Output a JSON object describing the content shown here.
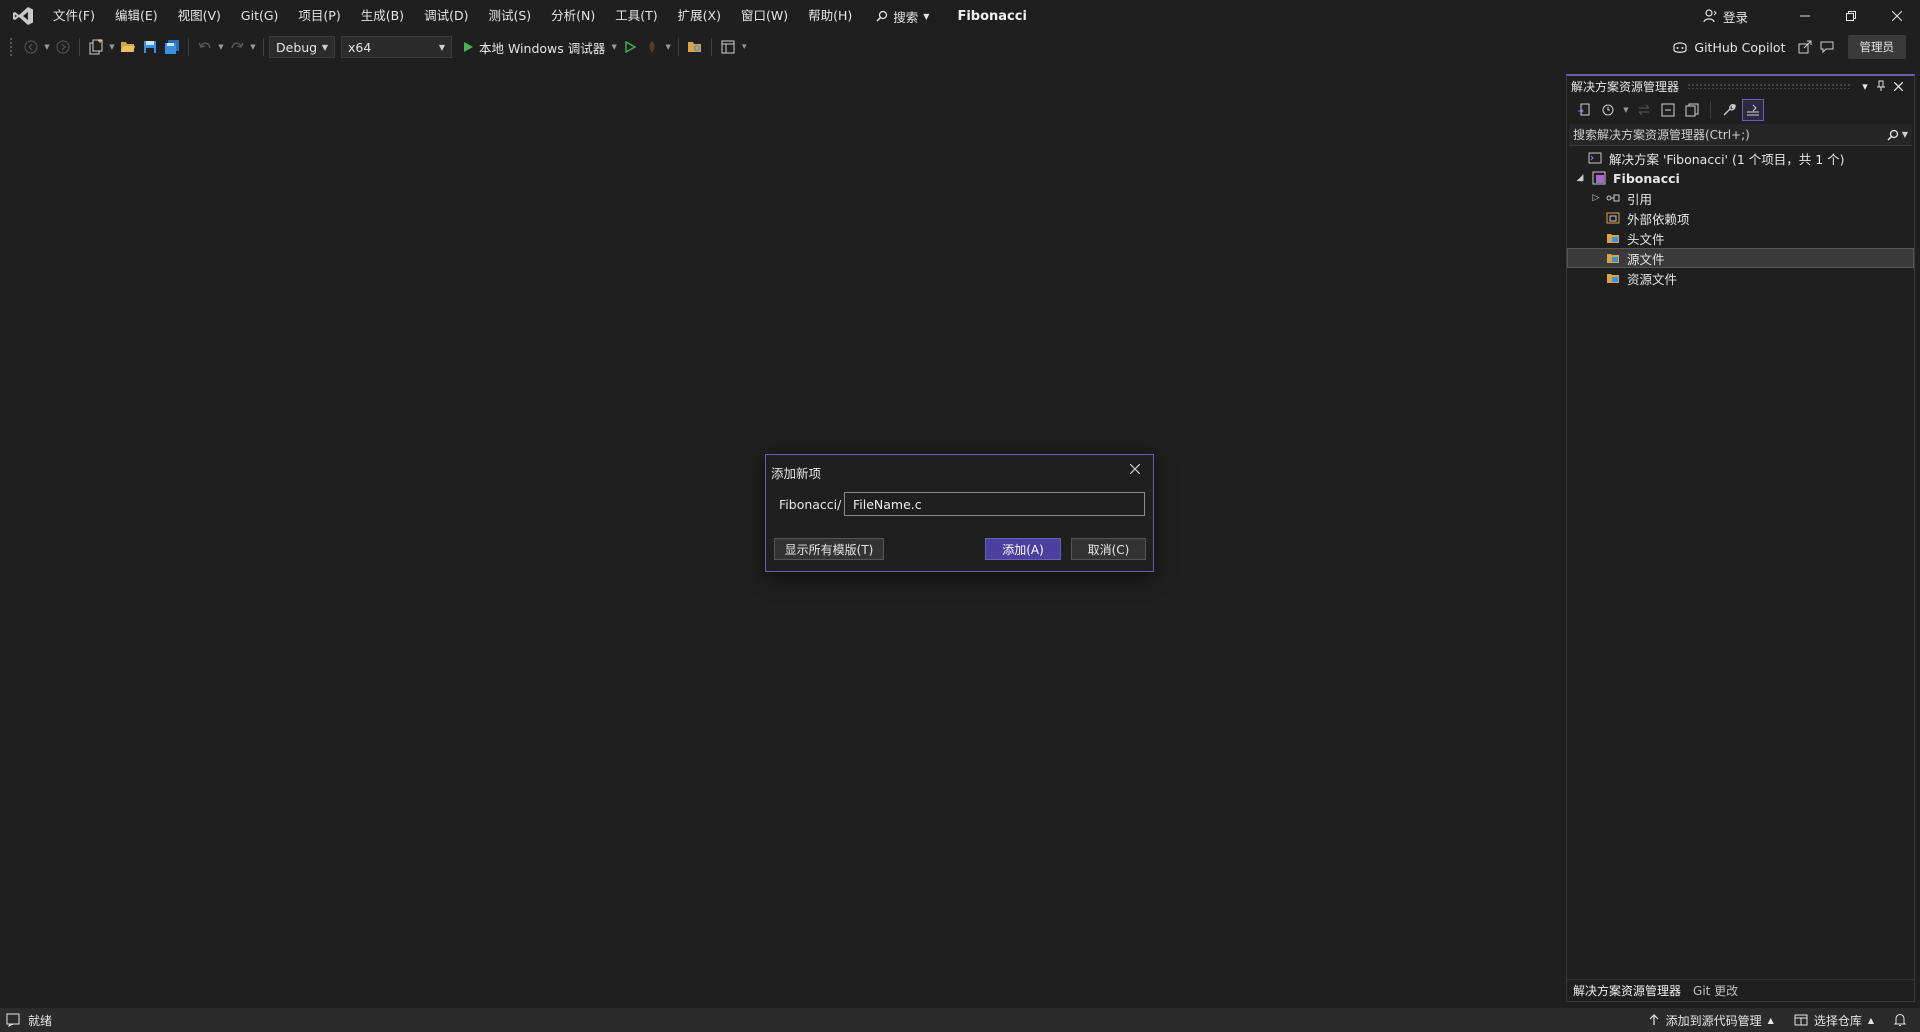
{
  "app": {
    "solution_name": "Fibonacci"
  },
  "menu": {
    "items": [
      "文件(F)",
      "编辑(E)",
      "视图(V)",
      "Git(G)",
      "项目(P)",
      "生成(B)",
      "调试(D)",
      "测试(S)",
      "分析(N)",
      "工具(T)",
      "扩展(X)",
      "窗口(W)",
      "帮助(H)"
    ],
    "search_label": "搜索",
    "login_label": "登录"
  },
  "toolbar": {
    "configuration": "Debug",
    "platform": "x64",
    "run_label": "本地 Windows 调试器",
    "copilot_label": "GitHub Copilot",
    "admin_badge": "管理员"
  },
  "solution_explorer": {
    "title": "解决方案资源管理器",
    "search_placeholder": "搜索解决方案资源管理器(Ctrl+;)",
    "tree": {
      "solution": "解决方案 'Fibonacci' (1 个项目，共 1 个)",
      "project": "Fibonacci",
      "references": "引用",
      "external_deps": "外部依赖项",
      "header_files": "头文件",
      "source_files": "源文件",
      "resource_files": "资源文件"
    },
    "tabs": [
      "解决方案资源管理器",
      "Git 更改"
    ]
  },
  "dialog": {
    "title": "添加新项",
    "path_prefix": "Fibonacci/",
    "filename_value": "FileName.c",
    "show_all_label": "显示所有模版(T)",
    "add_label": "添加(A)",
    "cancel_label": "取消(C)"
  },
  "statusbar": {
    "ready": "就绪",
    "add_source_control": "添加到源代码管理",
    "select_repo": "选择仓库"
  },
  "colors": {
    "accent": "#6b5fb5",
    "primary_button": "#4b3fa0",
    "background": "#1f1f1f",
    "run_green": "#3fb950"
  }
}
